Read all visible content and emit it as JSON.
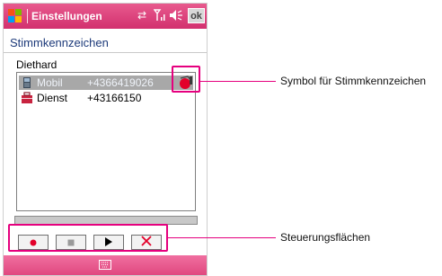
{
  "app": {
    "title": "Einstellungen",
    "ok_label": "ok",
    "icons": [
      "windows-start-icon",
      "sync-icon",
      "signal-icon",
      "volume-icon"
    ]
  },
  "page": {
    "heading": "Stimmkennzeichen",
    "contact_name": "Diethard"
  },
  "list": {
    "rows": [
      {
        "label": "Mobil",
        "number": "+4366419026",
        "icon": "mobile-phone-icon",
        "has_voice_tag": true
      },
      {
        "label": "Dienst",
        "number": "+43166150",
        "icon": "work-briefcase-icon",
        "has_voice_tag": false
      }
    ]
  },
  "controls": [
    {
      "name": "record-button",
      "icon": "record-icon"
    },
    {
      "name": "stop-button",
      "icon": "stop-icon"
    },
    {
      "name": "play-button",
      "icon": "play-icon"
    },
    {
      "name": "delete-button",
      "icon": "delete-icon"
    }
  ],
  "annotations": {
    "voice_tag_label": "Symbol für Stimmkennzeichen",
    "controls_label": "Steuerungsflächen"
  },
  "colors": {
    "title_bar": "#d2306e",
    "highlight": "#e5007e",
    "selection": "#a8a8a8",
    "record": "#e3002a",
    "delete": "#e3002a"
  }
}
